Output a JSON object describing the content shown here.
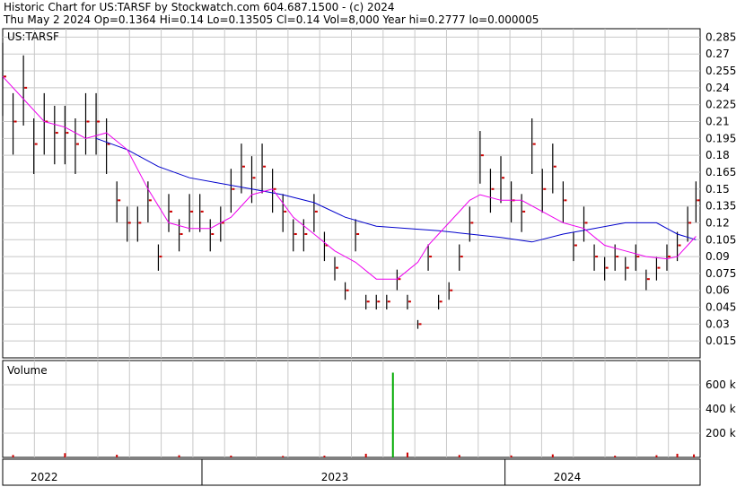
{
  "header": {
    "line1": "Historic Chart for US:TARSF by Stockwatch.com 604.687.1500 - (c) 2024",
    "line2": "Thu May  2 2024   Op=0.1364   Hi=0.14   Lo=0.13505   Cl=0.14   Vol=8,000   Year hi=0.2777   lo=0.000005"
  },
  "colors": {
    "background": "#ffffff",
    "grid": "#c8c8c8",
    "ohlc_bar": "#000000",
    "close_marker": "#cc0000",
    "long_moving_average": "#0000cc",
    "short_moving_average": "#ee00ee",
    "volume_bar": "#cc0000",
    "volume_spike": "#00aa00"
  },
  "chart_data": [
    {
      "type": "line",
      "panel": "price",
      "title": "US:TARSF",
      "ylim": [
        0.0,
        0.2925
      ],
      "y_ticks": [
        "0.285",
        "0.27",
        "0.255",
        "0.24",
        "0.225",
        "0.21",
        "0.195",
        "0.18",
        "0.165",
        "0.15",
        "0.135",
        "0.12",
        "0.105",
        "0.09",
        "0.075",
        "0.06",
        "0.045",
        "0.03",
        "0.015"
      ],
      "y_axis_side": "right",
      "grid": true,
      "x_range": [
        "2022-01",
        "2024-05"
      ],
      "x_labels": [
        {
          "label": "2022",
          "at": 0.2
        },
        {
          "label": "2023",
          "at": 1.6
        },
        {
          "label": "2024",
          "at": 2.72
        }
      ],
      "series": [
        {
          "role": "close",
          "style": "ohlc-bars",
          "x": [
            0.0,
            0.05,
            0.1,
            0.15,
            0.2,
            0.25,
            0.3,
            0.35,
            0.4,
            0.45,
            0.5,
            0.55,
            0.6,
            0.65,
            0.7,
            0.75,
            0.8,
            0.85,
            0.9,
            0.95,
            1.0,
            1.05,
            1.1,
            1.15,
            1.2,
            1.25,
            1.3,
            1.35,
            1.4,
            1.45,
            1.5,
            1.55,
            1.6,
            1.65,
            1.7,
            1.75,
            1.8,
            1.85,
            1.9,
            1.95,
            2.0,
            2.05,
            2.1,
            2.15,
            2.2,
            2.25,
            2.3,
            2.35,
            2.4,
            2.45,
            2.5,
            2.55,
            2.6,
            2.65,
            2.7,
            2.75,
            2.8,
            2.85,
            2.9,
            2.95,
            3.0,
            3.05,
            3.1,
            3.15,
            3.2,
            3.25,
            3.3,
            3.34
          ],
          "values": [
            0.25,
            0.21,
            0.24,
            0.19,
            0.21,
            0.2,
            0.2,
            0.19,
            0.21,
            0.21,
            0.19,
            0.14,
            0.12,
            0.12,
            0.14,
            0.09,
            0.13,
            0.11,
            0.13,
            0.13,
            0.11,
            0.12,
            0.15,
            0.17,
            0.16,
            0.17,
            0.15,
            0.13,
            0.11,
            0.11,
            0.13,
            0.1,
            0.08,
            0.06,
            0.11,
            0.05,
            0.05,
            0.05,
            0.07,
            0.05,
            0.03,
            0.09,
            0.05,
            0.06,
            0.09,
            0.12,
            0.18,
            0.15,
            0.16,
            0.14,
            0.13,
            0.19,
            0.15,
            0.17,
            0.14,
            0.1,
            0.12,
            0.09,
            0.08,
            0.09,
            0.08,
            0.09,
            0.07,
            0.08,
            0.09,
            0.1,
            0.12,
            0.14
          ]
        },
        {
          "role": "long_moving_average",
          "x": [
            0.45,
            0.6,
            0.75,
            0.9,
            1.05,
            1.2,
            1.35,
            1.5,
            1.65,
            1.8,
            1.95,
            2.1,
            2.25,
            2.4,
            2.55,
            2.7,
            2.85,
            3.0,
            3.15,
            3.25,
            3.34
          ],
          "values": [
            0.195,
            0.185,
            0.17,
            0.16,
            0.155,
            0.15,
            0.145,
            0.138,
            0.125,
            0.117,
            0.115,
            0.113,
            0.11,
            0.107,
            0.103,
            0.11,
            0.115,
            0.12,
            0.12,
            0.11,
            0.105
          ]
        },
        {
          "role": "short_moving_average",
          "x": [
            0.0,
            0.1,
            0.2,
            0.3,
            0.4,
            0.5,
            0.6,
            0.7,
            0.8,
            0.9,
            1.0,
            1.1,
            1.2,
            1.3,
            1.4,
            1.5,
            1.6,
            1.7,
            1.8,
            1.9,
            2.0,
            2.05,
            2.1,
            2.15,
            2.2,
            2.25,
            2.3,
            2.4,
            2.5,
            2.6,
            2.7,
            2.8,
            2.9,
            3.0,
            3.1,
            3.2,
            3.25,
            3.3,
            3.34
          ],
          "values": [
            0.25,
            0.23,
            0.21,
            0.205,
            0.195,
            0.2,
            0.185,
            0.15,
            0.12,
            0.115,
            0.115,
            0.125,
            0.145,
            0.15,
            0.125,
            0.11,
            0.095,
            0.085,
            0.07,
            0.07,
            0.085,
            0.1,
            0.11,
            0.12,
            0.13,
            0.14,
            0.145,
            0.14,
            0.14,
            0.13,
            0.12,
            0.115,
            0.1,
            0.095,
            0.09,
            0.088,
            0.09,
            0.1,
            0.108
          ]
        }
      ]
    },
    {
      "type": "bar",
      "panel": "volume",
      "title": "Volume",
      "ylim": [
        0,
        800000
      ],
      "y_ticks": [
        "600 k",
        "400 k",
        "200 k"
      ],
      "y_axis_side": "right",
      "grid": true,
      "spike": {
        "x": 1.88,
        "value": 700000
      },
      "x": [
        0.05,
        0.3,
        0.55,
        0.85,
        1.1,
        1.35,
        1.55,
        1.75,
        1.95,
        2.2,
        2.45,
        2.65,
        2.95,
        3.15,
        3.25,
        3.33
      ],
      "values": [
        20000,
        35000,
        22000,
        18000,
        15000,
        12000,
        14000,
        30000,
        40000,
        20000,
        16000,
        25000,
        14000,
        18000,
        30000,
        25000
      ]
    }
  ]
}
